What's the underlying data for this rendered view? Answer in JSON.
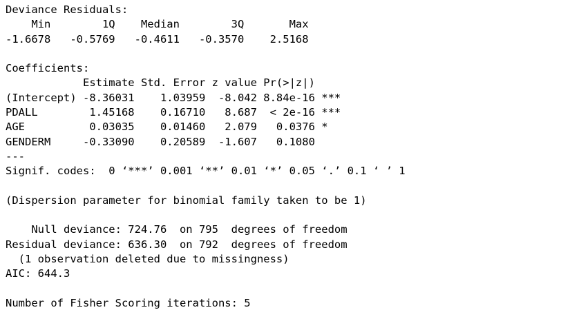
{
  "console": {
    "deviance_residuals": {
      "title": "Deviance Residuals:",
      "header": "    Min        1Q    Median        3Q       Max  ",
      "values": "-1.6678   -0.5769   -0.4611   -0.3570    2.5168  "
    },
    "coefficients": {
      "title": "Coefficients:",
      "header": "            Estimate Std. Error z value Pr(>|z|)    ",
      "rows": [
        "(Intercept) -8.36031    1.03959  -8.042 8.84e-16 ***",
        "PDALL        1.45168    0.16710   8.687  < 2e-16 ***",
        "AGE          0.03035    0.01460   2.079   0.0376 *  ",
        "GENDERM     -0.33090    0.20589  -1.607   0.1080    "
      ],
      "separator": "---",
      "signif_codes": "Signif. codes:  0 ‘***’ 0.001 ‘**’ 0.01 ‘*’ 0.05 ‘.’ 0.1 ‘ ’ 1"
    },
    "dispersion": "(Dispersion parameter for binomial family taken to be 1)",
    "null_deviance": "    Null deviance: 724.76  on 795  degrees of freedom",
    "residual_deviance": "Residual deviance: 636.30  on 792  degrees of freedom",
    "missingness": "  (1 observation deleted due to missingness)",
    "aic": "AIC: 644.3",
    "fisher_iterations": "Number of Fisher Scoring iterations: 5"
  }
}
